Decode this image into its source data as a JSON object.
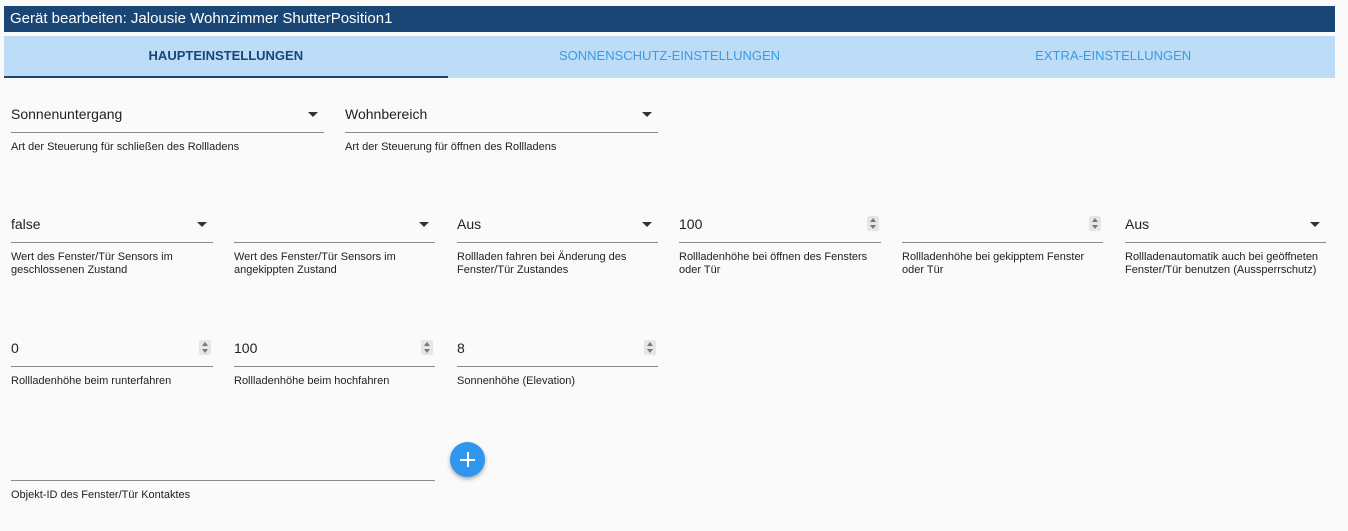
{
  "window": {
    "title": "Gerät bearbeiten: Jalousie Wohnzimmer ShutterPosition1"
  },
  "tabs": [
    {
      "label": "HAUPTEINSTELLUNGEN",
      "active": true
    },
    {
      "label": "SONNENSCHUTZ-EINSTELLUNGEN",
      "active": false
    },
    {
      "label": "EXTRA-EINSTELLUNGEN",
      "active": false
    }
  ],
  "row1": [
    {
      "value": "Sonnenuntergang",
      "label": "Art der Steuerung für schließen des Rollladens",
      "type": "select"
    },
    {
      "value": "Wohnbereich",
      "label": "Art der Steuerung für öffnen des Rollladens",
      "type": "select"
    }
  ],
  "row2": [
    {
      "value": "false",
      "label": "Wert des Fenster/Tür Sensors im geschlossenen Zustand",
      "type": "select"
    },
    {
      "value": "",
      "label": "Wert des Fenster/Tür Sensors im angekippten Zustand",
      "type": "select"
    },
    {
      "value": "Aus",
      "label": "Rollladen fahren bei Änderung des Fenster/Tür Zustandes",
      "type": "select"
    },
    {
      "value": "100",
      "label": "Rollladenhöhe bei öffnen des Fensters oder Tür",
      "type": "number"
    },
    {
      "value": "",
      "label": "Rollladenhöhe bei gekipptem Fenster oder Tür",
      "type": "number"
    },
    {
      "value": "Aus",
      "label": "Rollladenautomatik auch bei geöffneten Fenster/Tür benutzen (Aussperrschutz)",
      "type": "select"
    }
  ],
  "row3": [
    {
      "value": "0",
      "label": "Rollladenhöhe beim runterfahren",
      "type": "number"
    },
    {
      "value": "100",
      "label": "Rollladenhöhe beim hochfahren",
      "type": "number"
    },
    {
      "value": "8",
      "label": "Sonnenhöhe (Elevation)",
      "type": "number"
    }
  ],
  "row4": {
    "value": "",
    "label": "Objekt-ID des Fenster/Tür Kontaktes"
  },
  "colors": {
    "titlebar": "#1a4676",
    "tabbar": "#bcdcf8",
    "accent": "#2f96ee"
  },
  "icons": {
    "add_button": "plus-icon"
  }
}
